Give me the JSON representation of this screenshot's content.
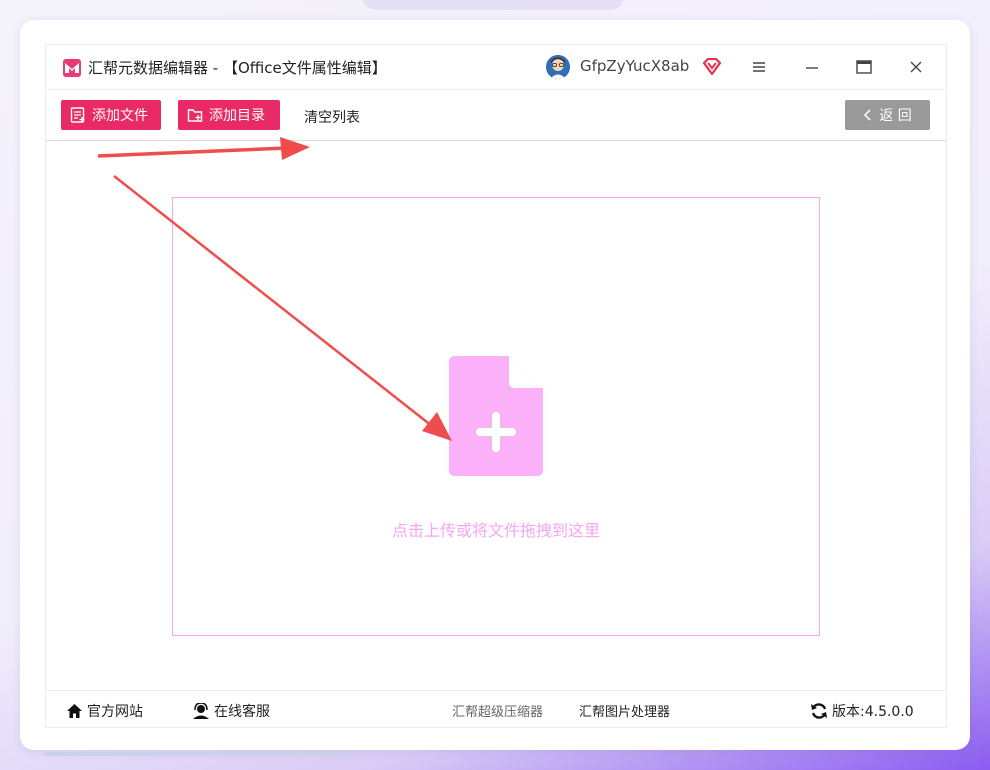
{
  "app": {
    "title": "汇帮元数据编辑器 - 【Office文件属性编辑】",
    "username": "GfpZyYucX8ab",
    "logo_icon": "app-logo-icon",
    "accent_color": "#ea2a66"
  },
  "window_controls": {
    "menu_icon": "≡",
    "minimize_icon": "—",
    "maximize_icon": "▭",
    "close_icon": "×"
  },
  "toolbar": {
    "add_file_label": "添加文件",
    "add_folder_label": "添加目录",
    "clear_list_label": "清空列表",
    "back_label": "返 回"
  },
  "dropzone": {
    "hint": "点击上传或将文件拖拽到这里",
    "border_color": "#f4a6f2",
    "icon": "file-add-icon"
  },
  "statusbar": {
    "website_label": "官方网站",
    "support_label": "在线客服",
    "compressor_label": "汇帮超级压缩器",
    "image_tool_label": "汇帮图片处理器",
    "version_label": "版本:4.5.0.0"
  },
  "annotations": {
    "arrow_color": "#ef4d4d"
  }
}
